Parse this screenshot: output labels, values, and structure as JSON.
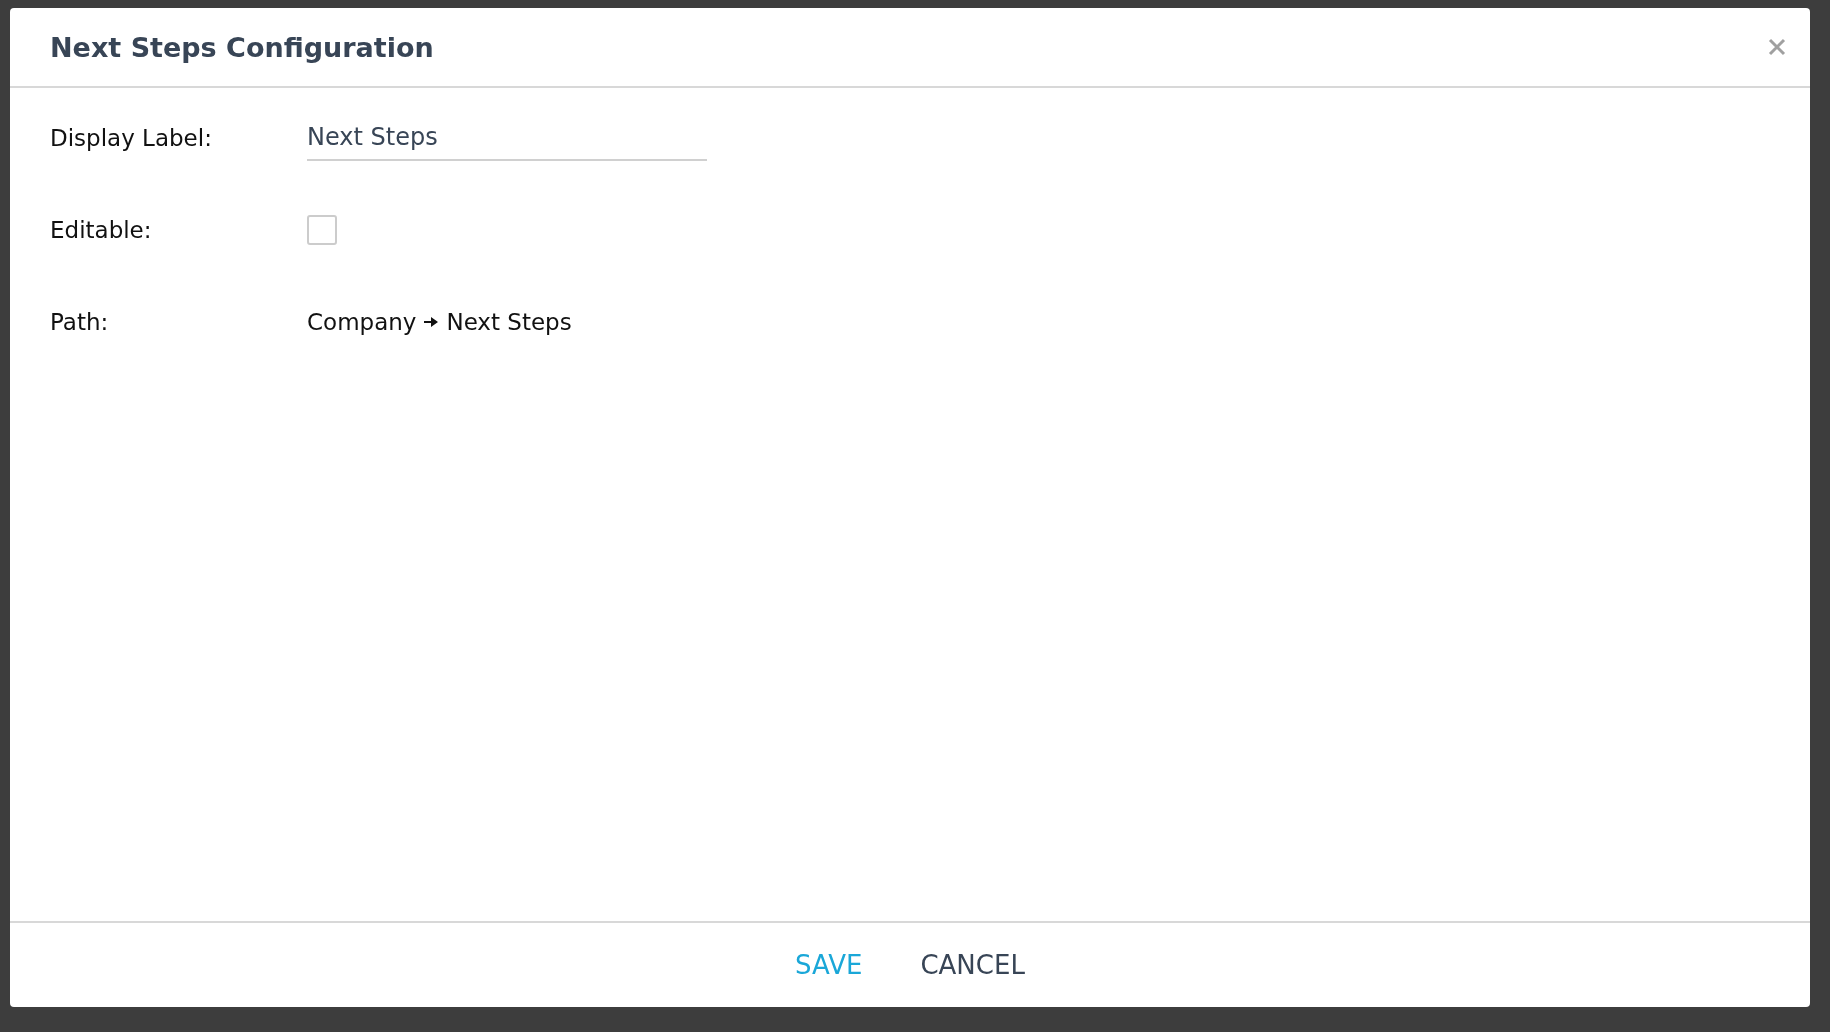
{
  "dialog": {
    "title": "Next Steps Configuration",
    "fields": [
      {
        "kind": "text",
        "label": "Display Label:",
        "value": "Next Steps"
      },
      {
        "kind": "checkbox",
        "label": "Editable:",
        "checked": false
      },
      {
        "kind": "path",
        "label": "Path:",
        "segments": [
          "Company",
          "Next Steps"
        ]
      }
    ],
    "buttons": [
      {
        "kind": "primary",
        "label": "SAVE"
      },
      {
        "kind": "secondary",
        "label": "CANCEL"
      }
    ]
  }
}
